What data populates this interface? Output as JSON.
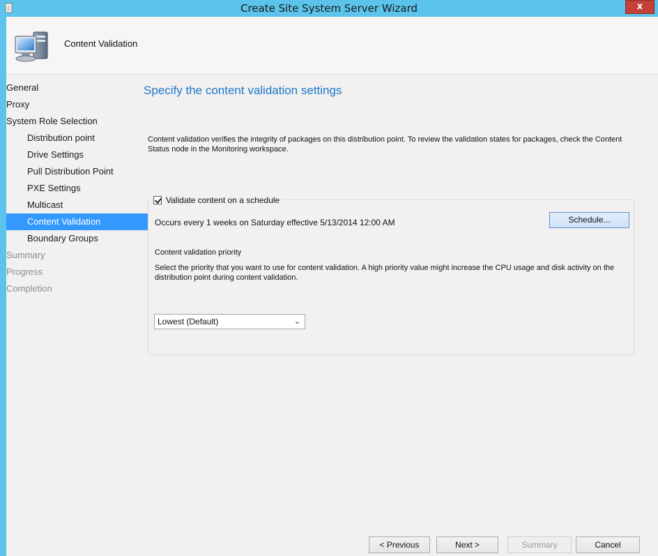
{
  "window": {
    "title": "Create Site System Server Wizard",
    "close_label": "x"
  },
  "header": {
    "title": "Content Validation",
    "icon": "computer-icon"
  },
  "nav": {
    "items": [
      {
        "label": "General",
        "level": 0,
        "state": "normal"
      },
      {
        "label": "Proxy",
        "level": 0,
        "state": "normal"
      },
      {
        "label": "System Role Selection",
        "level": 0,
        "state": "normal"
      },
      {
        "label": "Distribution point",
        "level": 1,
        "state": "normal"
      },
      {
        "label": "Drive Settings",
        "level": 1,
        "state": "normal"
      },
      {
        "label": "Pull Distribution Point",
        "level": 1,
        "state": "normal"
      },
      {
        "label": "PXE Settings",
        "level": 1,
        "state": "normal"
      },
      {
        "label": "Multicast",
        "level": 1,
        "state": "normal"
      },
      {
        "label": "Content Validation",
        "level": 1,
        "state": "selected"
      },
      {
        "label": "Boundary Groups",
        "level": 1,
        "state": "normal"
      },
      {
        "label": "Summary",
        "level": 0,
        "state": "disabled"
      },
      {
        "label": "Progress",
        "level": 0,
        "state": "disabled"
      },
      {
        "label": "Completion",
        "level": 0,
        "state": "disabled"
      }
    ]
  },
  "main": {
    "heading": "Specify the content validation settings",
    "description": "Content validation verifies the integrity of packages on this distribution point. To review the validation states for packages, check the Content Status node in the Monitoring workspace.",
    "validate_checkbox": {
      "label": "Validate content on a schedule",
      "checked": true
    },
    "schedule_text": "Occurs every 1 weeks on Saturday effective 5/13/2014 12:00 AM",
    "schedule_button": "Schedule...",
    "priority_label": "Content validation priority",
    "priority_description": "Select the priority that you want to use for content validation. A high priority value might increase the CPU usage and disk activity on the distribution point during content validation.",
    "priority_select": {
      "value": "Lowest (Default)"
    }
  },
  "footer": {
    "previous": "< Previous",
    "next": "Next >",
    "summary": "Summary",
    "cancel": "Cancel"
  },
  "colors": {
    "titlebar": "#5cc4ec",
    "selection": "#3399ff",
    "heading": "#1e78c8",
    "close": "#c6403a"
  }
}
